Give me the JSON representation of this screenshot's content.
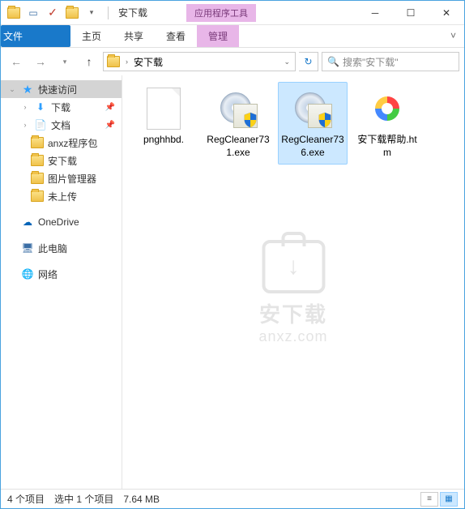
{
  "titlebar": {
    "title": "安下载",
    "context_tab": "应用程序工具"
  },
  "ribbon": {
    "file": "文件",
    "home": "主页",
    "share": "共享",
    "view": "查看",
    "manage": "管理"
  },
  "address": {
    "segments": [
      "安下载"
    ],
    "search_placeholder": "搜索\"安下载\""
  },
  "sidebar": {
    "quick_access": "快速访问",
    "items": [
      {
        "label": "下载",
        "pinned": true
      },
      {
        "label": "文档",
        "pinned": true
      },
      {
        "label": "anxz程序包",
        "pinned": false
      },
      {
        "label": "安下载",
        "pinned": false
      },
      {
        "label": "图片管理器",
        "pinned": false
      },
      {
        "label": "未上传",
        "pinned": false
      }
    ],
    "onedrive": "OneDrive",
    "this_pc": "此电脑",
    "network": "网络"
  },
  "files": [
    {
      "name": "pnghhbd.",
      "type": "blank",
      "selected": false
    },
    {
      "name": "RegCleaner731.exe",
      "type": "exe",
      "selected": false
    },
    {
      "name": "RegCleaner736.exe",
      "type": "exe",
      "selected": true
    },
    {
      "name": "安下载帮助.htm",
      "type": "htm",
      "selected": false
    }
  ],
  "watermark": {
    "cn": "安下载",
    "en": "anxz.com"
  },
  "status": {
    "count": "4 个项目",
    "selected": "选中 1 个项目",
    "size": "7.64 MB"
  }
}
